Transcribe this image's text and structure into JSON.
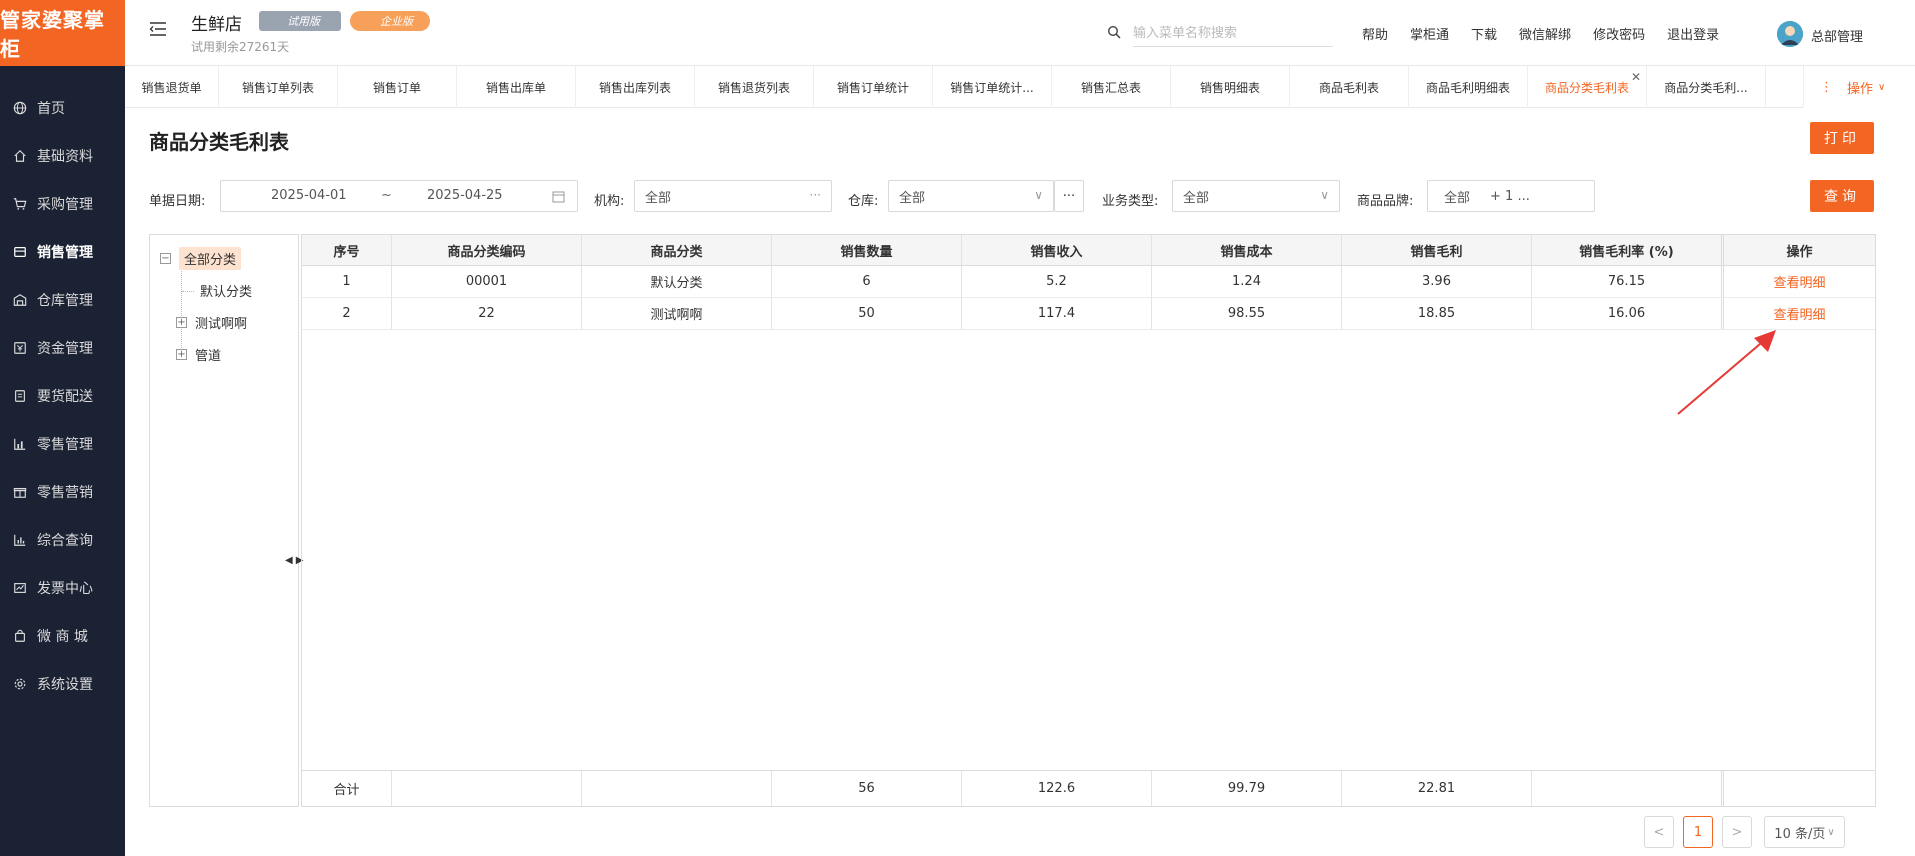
{
  "sidebar": {
    "logo": "管家婆聚掌柜",
    "items": [
      {
        "label": "首页",
        "icon": "globe-icon"
      },
      {
        "label": "基础资料",
        "icon": "home-icon"
      },
      {
        "label": "采购管理",
        "icon": "cart-icon"
      },
      {
        "label": "销售管理",
        "icon": "sales-icon"
      },
      {
        "label": "仓库管理",
        "icon": "warehouse-icon"
      },
      {
        "label": "资金管理",
        "icon": "money-icon"
      },
      {
        "label": "要货配送",
        "icon": "delivery-icon"
      },
      {
        "label": "零售管理",
        "icon": "retail-chart-icon"
      },
      {
        "label": "零售营销",
        "icon": "gift-icon"
      },
      {
        "label": "综合查询",
        "icon": "bar-chart-icon"
      },
      {
        "label": "发票中心",
        "icon": "invoice-icon"
      },
      {
        "label": "微 商 城",
        "icon": "bag-icon"
      },
      {
        "label": "系统设置",
        "icon": "settings-icon"
      }
    ],
    "active_index": 3
  },
  "header": {
    "store_name": "生鲜店",
    "badge_trial": "试用版",
    "badge_enterprise": "企业版",
    "trial_remaining": "试用剩余27261天",
    "search_placeholder": "输入菜单名称搜索",
    "links": [
      "帮助",
      "掌柜通",
      "下载",
      "微信解绑",
      "修改密码",
      "退出登录"
    ],
    "user": "总部管理"
  },
  "tabs": {
    "items": [
      "销售退货单",
      "销售订单列表",
      "销售订单",
      "销售出库单",
      "销售出库列表",
      "销售退货列表",
      "销售订单统计",
      "销售订单统计...",
      "销售汇总表",
      "销售明细表",
      "商品毛利表",
      "商品毛利明细表",
      "商品分类毛利表",
      "商品分类毛利..."
    ],
    "active_index": 12,
    "ops_label": "操作"
  },
  "page": {
    "title": "商品分类毛利表",
    "print_label": "打印",
    "query_label": "查询"
  },
  "filters": {
    "date_label": "单据日期:",
    "date_start": "2025-04-01",
    "date_sep": "~",
    "date_end": "2025-04-25",
    "org_label": "机构:",
    "org_value": "全部",
    "warehouse_label": "仓库:",
    "warehouse_value": "全部",
    "biz_label": "业务类型:",
    "biz_value": "全部",
    "brand_label": "商品品牌:",
    "brand_value": "全部",
    "brand_more": "+ 1 ..."
  },
  "tree": {
    "root": "全部分类",
    "children": [
      "默认分类",
      "测试啊啊",
      "管道"
    ]
  },
  "table": {
    "headers": [
      "序号",
      "商品分类编码",
      "商品分类",
      "销售数量",
      "销售收入",
      "销售成本",
      "销售毛利",
      "销售毛利率 (%)",
      "操作"
    ],
    "rows": [
      [
        "1",
        "00001",
        "默认分类",
        "6",
        "5.2",
        "1.24",
        "3.96",
        "76.15",
        "查看明细"
      ],
      [
        "2",
        "22",
        "测试啊啊",
        "50",
        "117.4",
        "98.55",
        "18.85",
        "16.06",
        "查看明细"
      ]
    ],
    "footer": [
      "合计",
      "",
      "",
      "56",
      "122.6",
      "99.79",
      "22.81",
      "",
      ""
    ]
  },
  "pagination": {
    "prev": "<",
    "current": "1",
    "next": ">",
    "page_size": "10 条/页"
  },
  "colors": {
    "accent": "#f26522",
    "sidebar_bg": "#1a2233"
  }
}
